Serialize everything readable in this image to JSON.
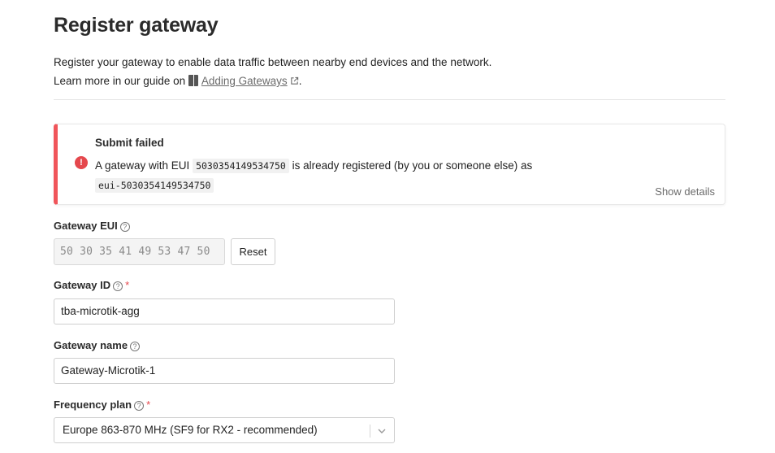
{
  "page": {
    "title": "Register gateway",
    "description_line1": "Register your gateway to enable data traffic between nearby end devices and the network.",
    "description_prefix": "Learn more in our guide on",
    "guide_link": "Adding Gateways",
    "description_suffix": "."
  },
  "alert": {
    "title": "Submit failed",
    "msg_prefix": "A gateway with EUI",
    "eui": "5030354149534750",
    "msg_mid": "is already registered (by you or someone else) as",
    "gateway_ref": "eui-5030354149534750",
    "details_label": "Show details",
    "color": "#f0555a"
  },
  "form": {
    "gateway_eui": {
      "label": "Gateway EUI",
      "value": "50 30 35 41 49 53 47 50",
      "reset_label": "Reset"
    },
    "gateway_id": {
      "label": "Gateway ID",
      "required_mark": "*",
      "value": "tba-microtik-agg"
    },
    "gateway_name": {
      "label": "Gateway name",
      "value": "Gateway-Microtik-1"
    },
    "frequency_plan": {
      "label": "Frequency plan",
      "required_mark": "*",
      "selected": "Europe 863-870 MHz (SF9 for RX2 - recommended)"
    }
  },
  "icons": {
    "help": "?",
    "error": "!"
  }
}
